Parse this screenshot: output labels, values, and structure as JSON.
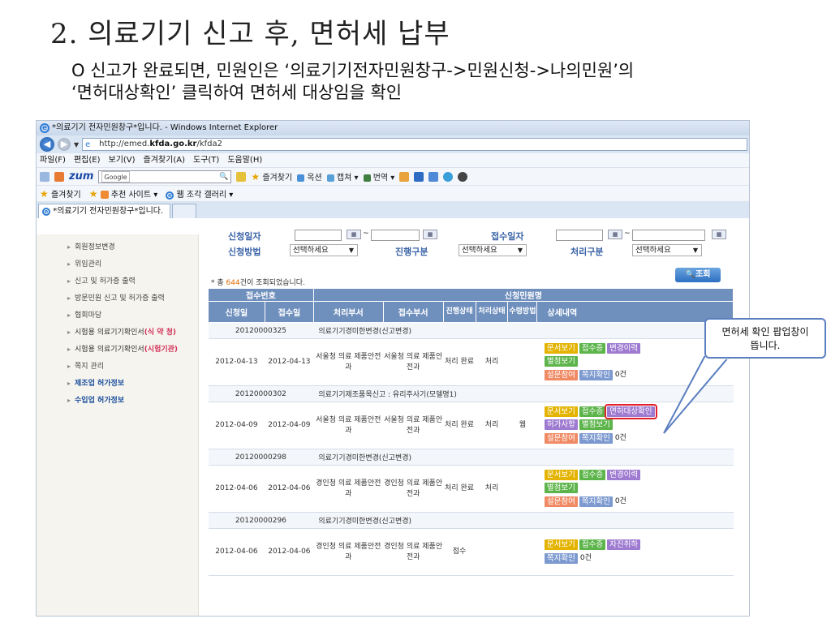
{
  "slide": {
    "title": "2. 의료기기 신고 후, 면허세 납부",
    "bullet_line1": "O 신고가 완료되면, 민원인은 ‘의료기기전자민원창구->민원신청->나의민원’의",
    "bullet_line2": "‘면허대상확인’ 클릭하여 면허세 대상임을 확인"
  },
  "browser": {
    "window_title": "*의료기기 전자민원창구*입니다. - Windows Internet Explorer",
    "url_prefix": "http://emed.",
    "url_domain": "kfda.go.kr",
    "url_suffix": "/kfda2",
    "menu": [
      "파일(F)",
      "편집(E)",
      "보기(V)",
      "즐겨찾기(A)",
      "도구(T)",
      "도움말(H)"
    ],
    "toolbar": {
      "brand": "zum",
      "search_placeholder": "Google",
      "items": [
        "즐겨찾기",
        "옥션",
        "캡쳐",
        "번역"
      ]
    },
    "favorites": {
      "label": "즐겨찾기",
      "items": [
        "추천 사이트",
        "웹 조각 갤러리"
      ]
    },
    "tab_title": "*의료기기 전자민원창구*입니다."
  },
  "sidebar": {
    "items": [
      {
        "label": "회원정보변경"
      },
      {
        "label": "위임관리"
      },
      {
        "label": "신고 및 허가증 출력"
      },
      {
        "label": "방문민원 신고 및 허가증 출력"
      },
      {
        "label": "협회마당"
      },
      {
        "label": "시험용 의료기기확인서",
        "tag": "(식 약 청)"
      },
      {
        "label": "시험용 의료기기확인서",
        "tag": "(시험기관)"
      },
      {
        "label": "쪽지 관리"
      },
      {
        "label": "제조업 허가정보"
      },
      {
        "label": "수입업 허가정보"
      }
    ]
  },
  "search": {
    "labels": {
      "apply_date": "신청일자",
      "receipt_date": "접수일자",
      "method": "신청방법",
      "progress": "진행구분",
      "process": "처리구분"
    },
    "select_placeholder": "선택하세요",
    "date_separator": "~",
    "button_label": "조회"
  },
  "results": {
    "count_prefix": "* 총 ",
    "count": "644",
    "count_suffix": "건이 조회되었습니다.",
    "headers": {
      "receipt_no": "접수번호",
      "petition_name": "신청민원명",
      "apply_date": "신청일",
      "receipt_date": "접수일",
      "proc_dept": "처리부서",
      "recv_dept": "접수부서",
      "progress": "진행상태",
      "process": "처리상태",
      "receive": "수령방법",
      "detail": "상세내역"
    },
    "rows": [
      {
        "receipt_no": "20120000325",
        "name": "의료기기경미한변경(신고변경)",
        "apply_date": "2012-04-13",
        "receipt_date": "2012-04-13",
        "proc_dept": "서울청 의료 제품안전과",
        "recv_dept": "서울청 의료 제품안전과",
        "progress": "처리 완료",
        "process": "처리",
        "receive": "",
        "buttons": [
          "문서보기",
          "접수증",
          "변경이력",
          "별첨보기",
          "설문참여",
          "쪽지확인"
        ],
        "count": "0건"
      },
      {
        "receipt_no": "20120000302",
        "name": "의료기기제조품목신고 : 유리주사기(모델명1)",
        "apply_date": "2012-04-09",
        "receipt_date": "2012-04-09",
        "proc_dept": "서울청 의료 제품안전과",
        "recv_dept": "서울청 의료 제품안전과",
        "progress": "처리 완료",
        "process": "처리",
        "receive": "웹",
        "buttons": [
          "문서보기",
          "접수증",
          "면허대상확인",
          "허가사항",
          "별첨보기",
          "설문참여",
          "쪽지확인"
        ],
        "count": "0건"
      },
      {
        "receipt_no": "20120000298",
        "name": "의료기기경미한변경(신고변경)",
        "apply_date": "2012-04-06",
        "receipt_date": "2012-04-06",
        "proc_dept": "경인청 의료 제품안전과",
        "recv_dept": "경인청 의료 제품안전과",
        "progress": "처리 완료",
        "process": "처리",
        "receive": "",
        "buttons": [
          "문서보기",
          "접수증",
          "변경이력",
          "별첨보기",
          "설문참여",
          "쪽지확인"
        ],
        "count": "0건"
      },
      {
        "receipt_no": "20120000296",
        "name": "의료기기경미한변경(신고변경)",
        "apply_date": "2012-04-06",
        "receipt_date": "2012-04-06",
        "proc_dept": "경인청 의료 제품안전과",
        "recv_dept": "경인청 의료 제품안전과",
        "progress": "접수",
        "process": "",
        "receive": "",
        "buttons": [
          "문서보기",
          "접수증",
          "자진취하",
          "쪽지확인"
        ],
        "count": "0건"
      }
    ]
  },
  "callout": {
    "line1": "면허세 확인 팝업창이",
    "line2": "뜹니다."
  },
  "colors": {
    "header_blue": "#6f8fbd",
    "highlight_red": "#e2202b",
    "button_yellow": "#e3b300",
    "button_green": "#5cb44a",
    "button_purple": "#9e7ad0",
    "button_orange": "#f08a64"
  }
}
